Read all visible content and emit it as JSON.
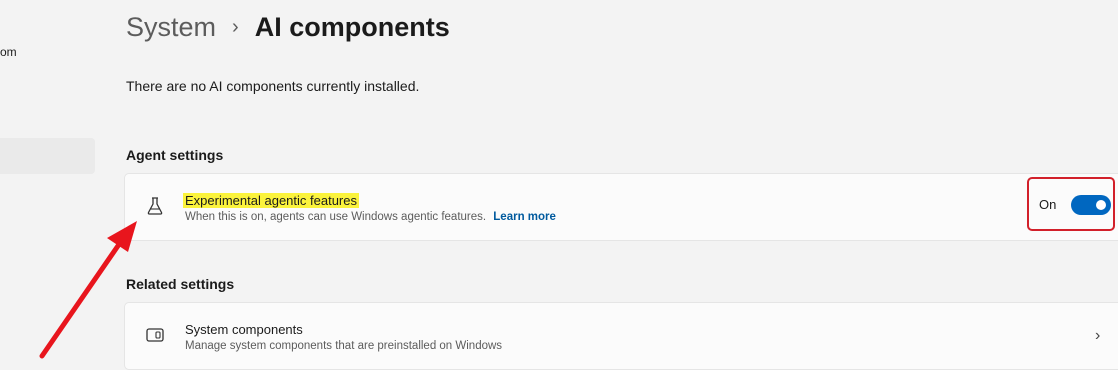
{
  "sidebar": {
    "fragment_text": "om"
  },
  "breadcrumb": {
    "parent": "System",
    "separator": "›",
    "current": "AI components"
  },
  "info": {
    "text": "There are no AI components currently installed."
  },
  "agent_settings": {
    "heading": "Agent settings",
    "experimental": {
      "title": "Experimental agentic features",
      "description": "When this is on, agents can use Windows agentic features.",
      "link": "Learn more",
      "toggle_label": "On",
      "toggle_state": "on",
      "icon": "flask-icon"
    }
  },
  "related_settings": {
    "heading": "Related settings",
    "system_components": {
      "title": "System components",
      "description": "Manage system components that are preinstalled on Windows",
      "icon": "window-icon",
      "chevron": "›"
    }
  },
  "colors": {
    "accent": "#0067c0",
    "highlight": "#fbf33c",
    "annotation_red": "#d2202a"
  }
}
